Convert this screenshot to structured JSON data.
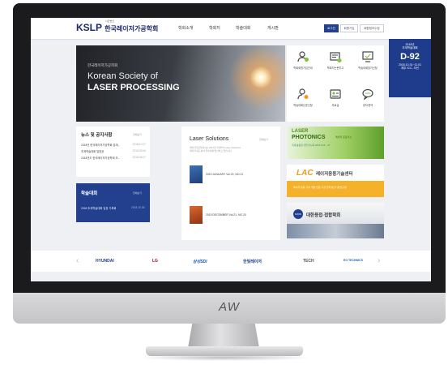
{
  "monitor": {
    "label": "AW"
  },
  "header": {
    "logo_mark": "KSLP",
    "logo_sub": "사단법인",
    "logo_text": "한국레이저가공학회",
    "nav": [
      "학회소개",
      "학회지",
      "학술대회",
      "게시판"
    ],
    "top_buttons": [
      "로그인",
      "회원가입",
      "회원정보수정"
    ]
  },
  "dday": {
    "line1": "2018년",
    "line2": "추계학술대회",
    "count": "D-92",
    "date": "2018.10.31~11.01",
    "place": "제주 ICC, 오션"
  },
  "hero": {
    "kor": "한국레이저가공학회",
    "eng1": "Korean Society of",
    "eng2": "LASER PROCESSING"
  },
  "quick_menu": [
    {
      "icon": "member-icon",
      "label": "학회회원가입안내"
    },
    {
      "icon": "document-icon",
      "label": "학회지논문투고"
    },
    {
      "icon": "monitor-icon",
      "label": "학술대회참가신청"
    },
    {
      "icon": "user-search-icon",
      "label": "학술대회논문신청"
    },
    {
      "icon": "id-card-icon",
      "label": "자료실"
    },
    {
      "icon": "chat-icon",
      "label": "공지/문의"
    }
  ],
  "news": {
    "title": "뉴스 및 공지사항",
    "more": "전체보기",
    "items": [
      {
        "text": "2018년 한국레이저가공학회 춘계...",
        "date": "2018.10.07"
      },
      {
        "text": "추계학술대회 일정표",
        "date": "2018.09.06"
      },
      {
        "text": "2018년도 한국레이저가공학회 추...",
        "date": "2018.08.07"
      }
    ]
  },
  "conference": {
    "title": "학술대회",
    "more": "전체보기",
    "item": "2018 추계학술대회 일정 기록회",
    "date": "2018.10.30"
  },
  "laser_solutions": {
    "title": "Laser Solutions",
    "more": "전체보기",
    "desc1": "레이저가공학회지는 2017년 7월부터 Laser Solutions",
    "desc2": "레이저가공 분야 학술지를 발간하고 있습니다",
    "issues": [
      {
        "label": "2019 JANUARY Vol.22, NO.21"
      },
      {
        "label": "2019 DECEMBER Vol.21, NO.20"
      }
    ]
  },
  "ads": {
    "photonics_top": "LASER",
    "photonics_main": "PHOTONICS",
    "photonics_sub": "레이저 포토닉스",
    "photonics_info": "국제 광융합 산업 전시회 2019.6.26 ~ 27",
    "lac_main": "LAC",
    "lac_text": "레이저응용기술센터",
    "lac_sub": "레이저 응용 기술 개발 전문 기관 한국생산기술연구원",
    "kwjs_badge": "KWJS",
    "kwjs_text": "대한용접·접합학회"
  },
  "partners": [
    "HYUNDAI",
    "LG",
    "삼성SDI",
    "한빛레이저",
    "TECH",
    "EO TECHNICS"
  ],
  "colors": {
    "navy": "#22408e",
    "accent_green": "#84c341",
    "accent_orange": "#f39a1b"
  }
}
